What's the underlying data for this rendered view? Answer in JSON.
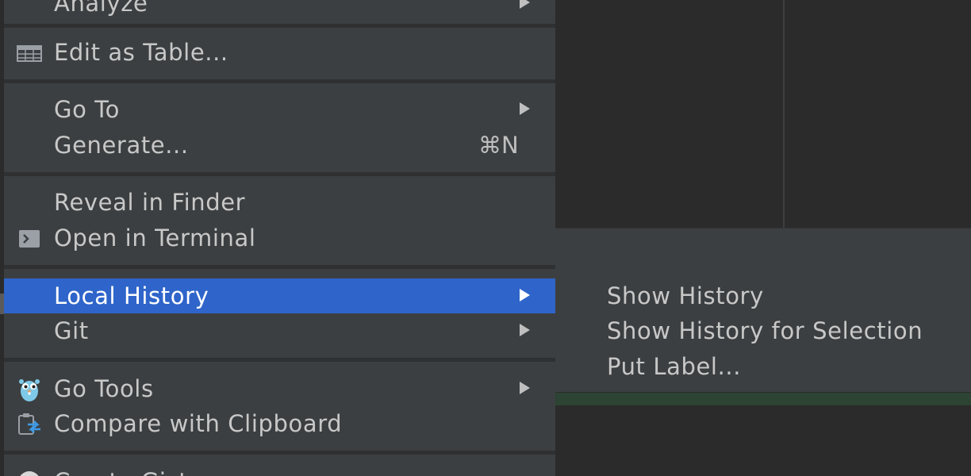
{
  "menu": {
    "items": [
      {
        "label": "Analyze",
        "has_submenu": true
      },
      {
        "label": "Edit as Table...",
        "icon": "table-icon"
      },
      {
        "label": "Go To",
        "has_submenu": true
      },
      {
        "label": "Generate...",
        "shortcut": "⌘N"
      },
      {
        "label": "Reveal in Finder"
      },
      {
        "label": "Open in Terminal",
        "icon": "terminal-icon"
      },
      {
        "label": "Local History",
        "has_submenu": true,
        "selected": true
      },
      {
        "label": "Git",
        "has_submenu": true
      },
      {
        "label": "Go Tools",
        "has_submenu": true,
        "icon": "gopher-icon"
      },
      {
        "label": "Compare with Clipboard",
        "icon": "compare-clipboard-icon"
      },
      {
        "label": "Create Gist...",
        "icon": "github-icon"
      }
    ]
  },
  "submenu": {
    "items": [
      {
        "label": "Show History"
      },
      {
        "label": "Show History for Selection"
      },
      {
        "label": "Put Label..."
      }
    ]
  },
  "colors": {
    "menu_bg": "#3c3f41",
    "selection": "#2f65ca",
    "text": "#c8c8c8",
    "editor_bg": "#2b2b2b"
  }
}
